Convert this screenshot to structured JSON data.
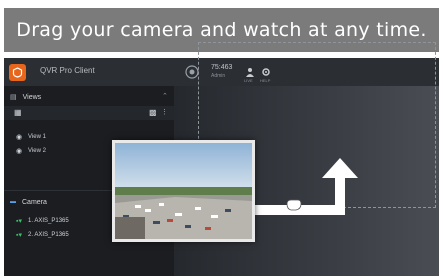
{
  "banner": {
    "text": "Drag your camera and watch at any time."
  },
  "app": {
    "title": "QVR Pro Client",
    "user": {
      "name": "75:463",
      "role": "Admin"
    },
    "icons": {
      "logo": "qvr-logo-icon",
      "camera": "camera-icon",
      "account": "user-icon",
      "settings": "settings-icon"
    },
    "top_small_labels": [
      "LIVE",
      "HELP"
    ]
  },
  "sidebar": {
    "views_label": "Views",
    "views": [
      {
        "label": "View 1",
        "icon": "eye-icon"
      },
      {
        "label": "View 2",
        "icon": "eye-icon"
      }
    ],
    "cameras_label": "Camera",
    "cameras": [
      {
        "label": "1. AXIS_P1365",
        "status": "online"
      },
      {
        "label": "2. AXIS_P1365",
        "status": "online"
      }
    ]
  },
  "colors": {
    "accent": "#e8651c",
    "online": "#38c36a",
    "banner": "#7b7b7b"
  }
}
